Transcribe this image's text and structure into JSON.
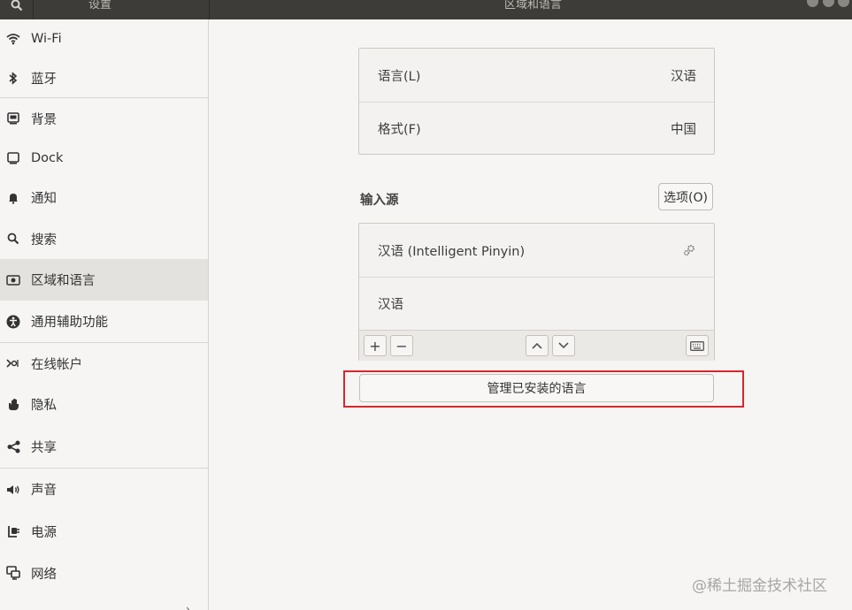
{
  "titlebar": {
    "left_title": "设置",
    "center_title": "区域和语言"
  },
  "sidebar": {
    "items": [
      {
        "label": "Wi-Fi",
        "icon": "wifi-icon"
      },
      {
        "label": "蓝牙",
        "icon": "bluetooth-icon"
      },
      {
        "label": "背景",
        "icon": "background-icon"
      },
      {
        "label": "Dock",
        "icon": "dock-icon"
      },
      {
        "label": "通知",
        "icon": "bell-icon"
      },
      {
        "label": "搜索",
        "icon": "search-icon"
      },
      {
        "label": "区域和语言",
        "icon": "region-icon",
        "selected": true
      },
      {
        "label": "通用辅助功能",
        "icon": "accessibility-icon"
      },
      {
        "label": "在线帐户",
        "icon": "online-accounts-icon"
      },
      {
        "label": "隐私",
        "icon": "hand-icon"
      },
      {
        "label": "共享",
        "icon": "share-icon"
      },
      {
        "label": "声音",
        "icon": "speaker-icon"
      },
      {
        "label": "电源",
        "icon": "power-icon"
      },
      {
        "label": "网络",
        "icon": "network-icon"
      }
    ]
  },
  "language": {
    "language_label": "语言(L)",
    "language_value": "汉语",
    "format_label": "格式(F)",
    "format_value": "中国"
  },
  "input_sources": {
    "title": "输入源",
    "options_label": "选项(O)",
    "sources": [
      {
        "label": "汉语 (Intelligent Pinyin)",
        "has_settings": true
      },
      {
        "label": "汉语",
        "has_settings": false
      }
    ],
    "add_label": "+",
    "remove_label": "−"
  },
  "manage_button_label": "管理已安装的语言",
  "watermark": "@稀土掘金技术社区",
  "colors": {
    "highlight": "#d9262a",
    "titlebar": "#3d3c38",
    "selected_row": "#e4e2de"
  }
}
